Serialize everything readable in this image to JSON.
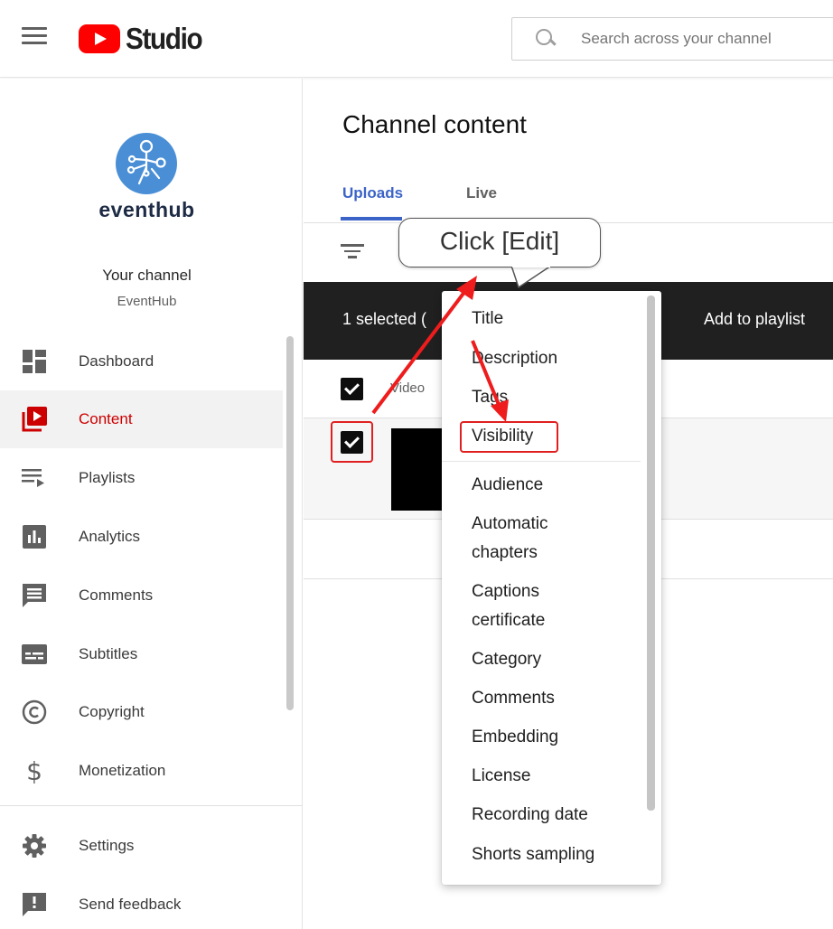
{
  "header": {
    "logo_text": "Studio",
    "search_placeholder": "Search across your channel"
  },
  "sidebar": {
    "brand_name": "eventhub",
    "your_channel_label": "Your channel",
    "channel_handle": "EventHub",
    "items": [
      {
        "label": "Dashboard",
        "icon": "dashboard-icon",
        "active": false
      },
      {
        "label": "Content",
        "icon": "content-icon",
        "active": true
      },
      {
        "label": "Playlists",
        "icon": "playlists-icon",
        "active": false
      },
      {
        "label": "Analytics",
        "icon": "analytics-icon",
        "active": false
      },
      {
        "label": "Comments",
        "icon": "comments-icon",
        "active": false
      },
      {
        "label": "Subtitles",
        "icon": "subtitles-icon",
        "active": false
      },
      {
        "label": "Copyright",
        "icon": "copyright-icon",
        "active": false
      },
      {
        "label": "Monetization",
        "icon": "monetization-icon",
        "active": false
      }
    ],
    "bottom_items": [
      {
        "label": "Settings",
        "icon": "settings-icon"
      },
      {
        "label": "Send feedback",
        "icon": "feedback-icon"
      }
    ]
  },
  "main": {
    "title": "Channel content",
    "tabs": [
      {
        "label": "Uploads",
        "active": true
      },
      {
        "label": "Live",
        "active": false
      }
    ],
    "action_bar": {
      "selected_text": "1 selected (",
      "add_to_playlist": "Add to playlist"
    },
    "table": {
      "column_video": "Video"
    }
  },
  "edit_menu": {
    "items": [
      "Title",
      "Description",
      "Tags",
      "Visibility"
    ],
    "items_more": [
      "Audience",
      "Automatic\nchapters",
      "Captions\ncertificate",
      "Category",
      "Comments",
      "Embedding",
      "License",
      "Recording date",
      "Shorts sampling"
    ]
  },
  "annotation": {
    "callout_text": "Click [Edit]"
  },
  "colors": {
    "accent_blue": "#3c64c8",
    "active_red": "#cc0000",
    "brand_red": "#ff0000",
    "annotation_red": "#e02020",
    "action_bar_bg": "#202020"
  }
}
